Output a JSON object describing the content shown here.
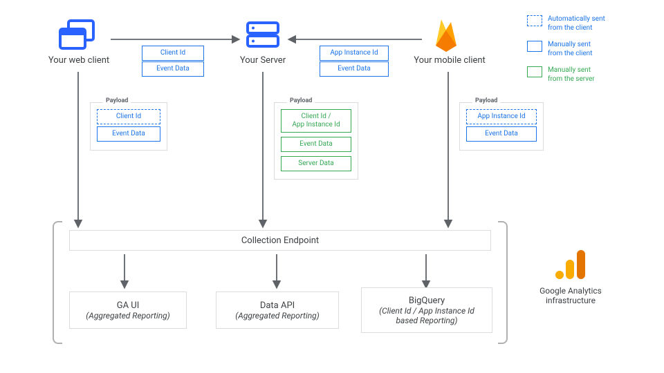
{
  "nodes": {
    "web": {
      "label": "Your web client"
    },
    "server": {
      "label": "Your Server"
    },
    "mobile": {
      "label": "Your mobile client"
    }
  },
  "top_flows": {
    "web_to_server": {
      "items": [
        "Client Id",
        "Event Data"
      ]
    },
    "mobile_to_server": {
      "items": [
        "App Instance Id",
        "Event Data"
      ]
    }
  },
  "payloads": {
    "web": {
      "title": "Payload",
      "items": [
        {
          "text": "Client Id",
          "style": "blue-dashed"
        },
        {
          "text": "Event Data",
          "style": "blue-solid"
        }
      ]
    },
    "server": {
      "title": "Payload",
      "items": [
        {
          "text": "Client Id /\nApp Instance Id",
          "style": "green-solid"
        },
        {
          "text": "Event Data",
          "style": "green-solid"
        },
        {
          "text": "Server Data",
          "style": "green-solid"
        }
      ]
    },
    "mobile": {
      "title": "Payload",
      "items": [
        {
          "text": "App Instance Id",
          "style": "blue-dashed"
        },
        {
          "text": "Event Data",
          "style": "blue-solid"
        }
      ]
    }
  },
  "collection": {
    "label": "Collection Endpoint"
  },
  "outputs": {
    "ga_ui": {
      "title": "GA UI",
      "sub": "(Aggregated Reporting)"
    },
    "dataapi": {
      "title": "Data API",
      "sub": "(Aggregated Reporting)"
    },
    "bq": {
      "title": "BigQuery",
      "sub": "(Client Id / App Instance Id\nbased Reporting)"
    }
  },
  "ga_infra": {
    "label": "Google Analytics\ninfrastructure"
  },
  "legend": {
    "auto": "Automatically sent\nfrom the client",
    "man_b": "Manually sent\nfrom the client",
    "man_g": "Manually sent\nfrom the server"
  }
}
